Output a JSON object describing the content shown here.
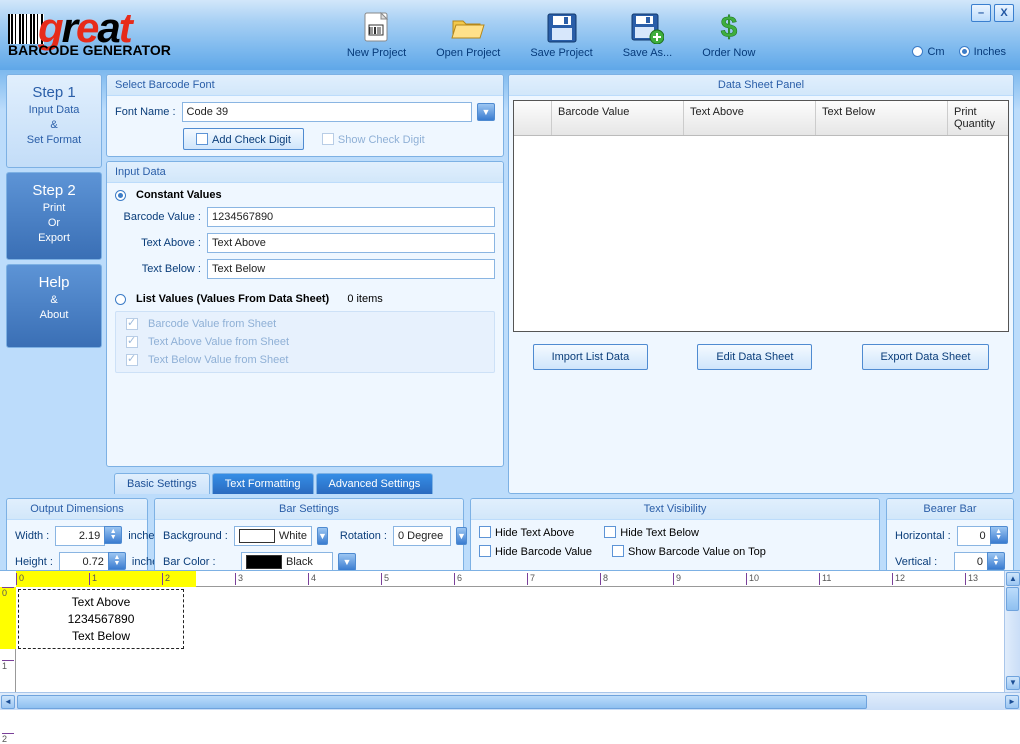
{
  "logo": {
    "subtitle": "BARCODE GENERATOR"
  },
  "toolbar": {
    "new": "New  Project",
    "open": "Open  Project",
    "save": "Save Project",
    "saveas": "Save As...",
    "order": "Order Now"
  },
  "units": {
    "cm": "Cm",
    "inches": "Inches",
    "selected": "inches"
  },
  "side": {
    "step1_title": "Step 1",
    "step1_sub": "Input Data\n&\nSet Format",
    "step2_title": "Step 2",
    "step2_sub": "Print\nOr\nExport",
    "help_title": "Help",
    "help_sub": "&\nAbout"
  },
  "select_font": {
    "title": "Select Barcode Font",
    "fontname_label": "Font Name :",
    "fontname_value": "Code 39",
    "add_check": "Add Check Digit",
    "show_check": "Show Check Digit"
  },
  "input_data": {
    "title": "Input Data",
    "constant": "Constant Values",
    "barcode_label": "Barcode Value :",
    "barcode_value": "1234567890",
    "above_label": "Text Above :",
    "above_value": "Text Above",
    "below_label": "Text Below :",
    "below_value": "Text Below",
    "list_values": "List Values (Values From Data Sheet)",
    "list_count": "0 items",
    "from_barcode": "Barcode Value from Sheet",
    "from_above": "Text Above Value from Sheet",
    "from_below": "Text Below Value from Sheet"
  },
  "datasheet": {
    "title": "Data Sheet Panel",
    "col_barcode": "Barcode Value",
    "col_above": "Text Above",
    "col_below": "Text Below",
    "col_qty": "Print Quantity",
    "import": "Import List Data",
    "edit": "Edit Data Sheet",
    "export": "Export Data Sheet"
  },
  "tabs": {
    "basic": "Basic Settings",
    "text": "Text Formatting",
    "adv": "Advanced Settings"
  },
  "outdim": {
    "title": "Output Dimensions",
    "width_label": "Width :",
    "width_value": "2.19",
    "width_unit": "inches",
    "height_label": "Height :",
    "height_value": "0.72",
    "height_unit": "inches"
  },
  "barset": {
    "title": "Bar Settings",
    "bg_label": "Background :",
    "bg_value": "White",
    "bg_color": "#ffffff",
    "bar_label": "Bar Color :",
    "bar_value": "Black",
    "bar_color": "#000000",
    "rot_label": "Rotation :",
    "rot_value": "0 Degree"
  },
  "textvis": {
    "title": "Text Visibility",
    "hide_above": "Hide Text Above",
    "hide_below": "Hide Text Below",
    "hide_barcode": "Hide Barcode Value",
    "show_top": "Show Barcode Value on Top"
  },
  "bearer": {
    "title": "Bearer Bar",
    "h_label": "Horizontal :",
    "h_value": "0",
    "v_label": "Vertical :",
    "v_value": "0"
  },
  "preview": {
    "above": "Text Above",
    "value": "1234567890",
    "below": "Text Below"
  }
}
